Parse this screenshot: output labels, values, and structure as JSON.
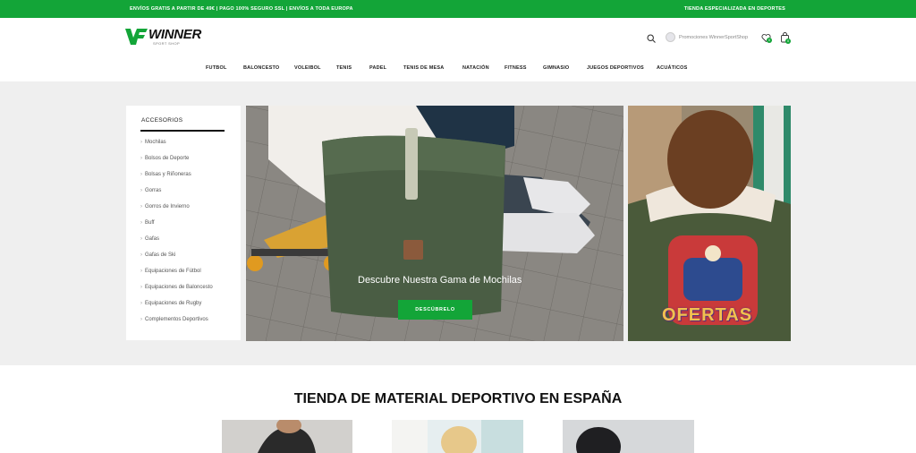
{
  "topbar": {
    "left_text": "ENVÍOS GRATIS A PARTIR DE 49€ | PAGO 100% SEGURO SSL | ENVÍOS A TODA EUROPA",
    "right_text": "TIENDA ESPECIALIZADA EN DEPORTES"
  },
  "header": {
    "logo_brand": "WINNER",
    "logo_sub": "SPORT SHOP",
    "account_label": "Promociones WinnerSportShop",
    "wishlist_count": "0",
    "cart_count": "0"
  },
  "nav": [
    "FUTBOL",
    "BALONCESTO",
    "VOLEIBOL",
    "TENIS",
    "PADEL",
    "TENIS DE MESA",
    "NATACIÓN",
    "FITNESS",
    "GIMNASIO",
    "JUEGOS DEPORTIVOS",
    "ACUÁTICOS"
  ],
  "sidebar": {
    "title": "ACCESORIOS",
    "items": [
      "Mochilas",
      "Bolsos de Deporte",
      "Bolsas y Riñoneras",
      "Gorras",
      "Gorros de Invierno",
      "Buff",
      "Gafas",
      "Gafas de Ski",
      "Equipaciones de Fútbol",
      "Equipaciones de Baloncesto",
      "Equipaciones de Rugby",
      "Complementos Deportivos"
    ]
  },
  "hero": {
    "caption": "Descubre Nuestra Gama de Mochilas",
    "button_label": "DESCÚBRELO"
  },
  "promo": {
    "label": "OFERTAS"
  },
  "section": {
    "title": "TIENDA DE MATERIAL DEPORTIVO EN ESPAÑA"
  },
  "colors": {
    "brand_green": "#13a538",
    "band_bg": "#efefef"
  }
}
